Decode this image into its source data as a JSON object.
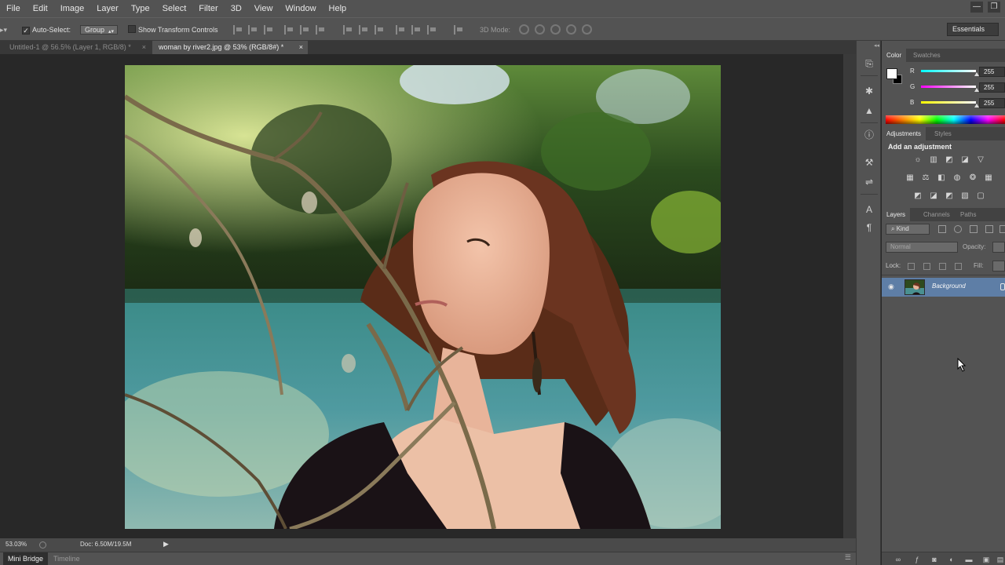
{
  "menu": [
    "File",
    "Edit",
    "Image",
    "Layer",
    "Type",
    "Select",
    "Filter",
    "3D",
    "View",
    "Window",
    "Help"
  ],
  "window_controls": [
    "—",
    "❐"
  ],
  "options": {
    "auto_select_label": "Auto-Select:",
    "auto_select_checked": true,
    "auto_select_target": "Group",
    "transform_controls_label": "Show Transform Controls",
    "transform_controls_checked": false,
    "mode_3d_label": "3D Mode:"
  },
  "workspace": "Essentials",
  "tabs": [
    {
      "title": "Untitled-1 @ 56.5% (Layer 1, RGB/8) *",
      "close": "×",
      "active": false
    },
    {
      "title": "woman by river2.jpg @ 53% (RGB/8#) *",
      "close": "×",
      "active": true
    }
  ],
  "status": {
    "zoom": "53.03%",
    "doc_size": "Doc: 6.50M/19.5M",
    "arrow": "▶"
  },
  "bottom_tabs": [
    "Mini Bridge",
    "Timeline"
  ],
  "panels": {
    "color_tabs": [
      "Color",
      "Swatches"
    ],
    "color": {
      "foreground": "#ffffff",
      "background": "#000000",
      "channels": [
        {
          "label": "R",
          "value": "255",
          "track": "#00e5ff"
        },
        {
          "label": "G",
          "value": "255",
          "track": "#ff33ff"
        },
        {
          "label": "B",
          "value": "255",
          "track": "#ffff33"
        }
      ]
    },
    "adjustment_tabs": [
      "Adjustments",
      "Styles"
    ],
    "adjustments_title": "Add an adjustment",
    "adjustment_icons": [
      [
        "brightness-contrast-icon",
        "levels-icon",
        "curves-icon",
        "exposure-icon",
        "vibrance-icon"
      ],
      [
        "hue-saturation-icon",
        "color-balance-icon",
        "black-white-icon",
        "photo-filter-icon",
        "channel-mixer-icon",
        "color-lookup-icon"
      ],
      [
        "invert-icon",
        "posterize-icon",
        "threshold-icon",
        "gradient-map-icon",
        "selective-color-icon"
      ]
    ],
    "layers_tabs": [
      "Layers",
      "Channels",
      "Paths"
    ],
    "layers": {
      "filter_kind": "Kind",
      "blend_mode": "Normal",
      "opacity_label": "Opacity:",
      "lock_label": "Lock:",
      "fill_label": "Fill:",
      "items": [
        {
          "name": "Background",
          "visible": true,
          "locked": true,
          "selected": true
        }
      ]
    },
    "selected_color": "#5e7ea6"
  },
  "tools": [
    "history-icon",
    "brush-settings-icon",
    "histogram-icon",
    "info-icon",
    "properties-icon",
    "tool-presets-icon",
    "character-icon",
    "paragraph-icon"
  ]
}
